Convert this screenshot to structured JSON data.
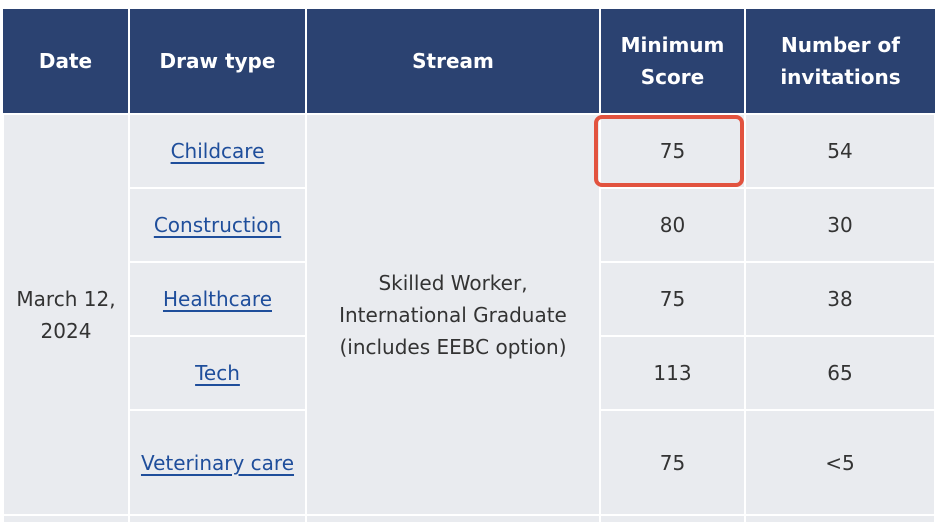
{
  "headers": {
    "date": "Date",
    "draw_type": "Draw type",
    "stream": "Stream",
    "minimum_score": "Minimum Score",
    "invitations": "Number of invitations"
  },
  "date": "March 12, 2024",
  "stream": "Skilled Worker, International Graduate (includes EEBC option)",
  "rows": [
    {
      "draw_type": "Childcare",
      "minimum_score": "75",
      "invitations": "54",
      "highlighted": true
    },
    {
      "draw_type": "Construction",
      "minimum_score": "80",
      "invitations": "30"
    },
    {
      "draw_type": "Healthcare",
      "minimum_score": "75",
      "invitations": "38"
    },
    {
      "draw_type": "Tech",
      "minimum_score": "113",
      "invitations": "65"
    },
    {
      "draw_type": "Veterinary care",
      "minimum_score": "75",
      "invitations": "<5"
    }
  ],
  "colors": {
    "header_bg": "#2b4271",
    "cell_bg": "#e9ebef",
    "link": "#1f4e9b",
    "highlight_border": "#e2533f"
  }
}
